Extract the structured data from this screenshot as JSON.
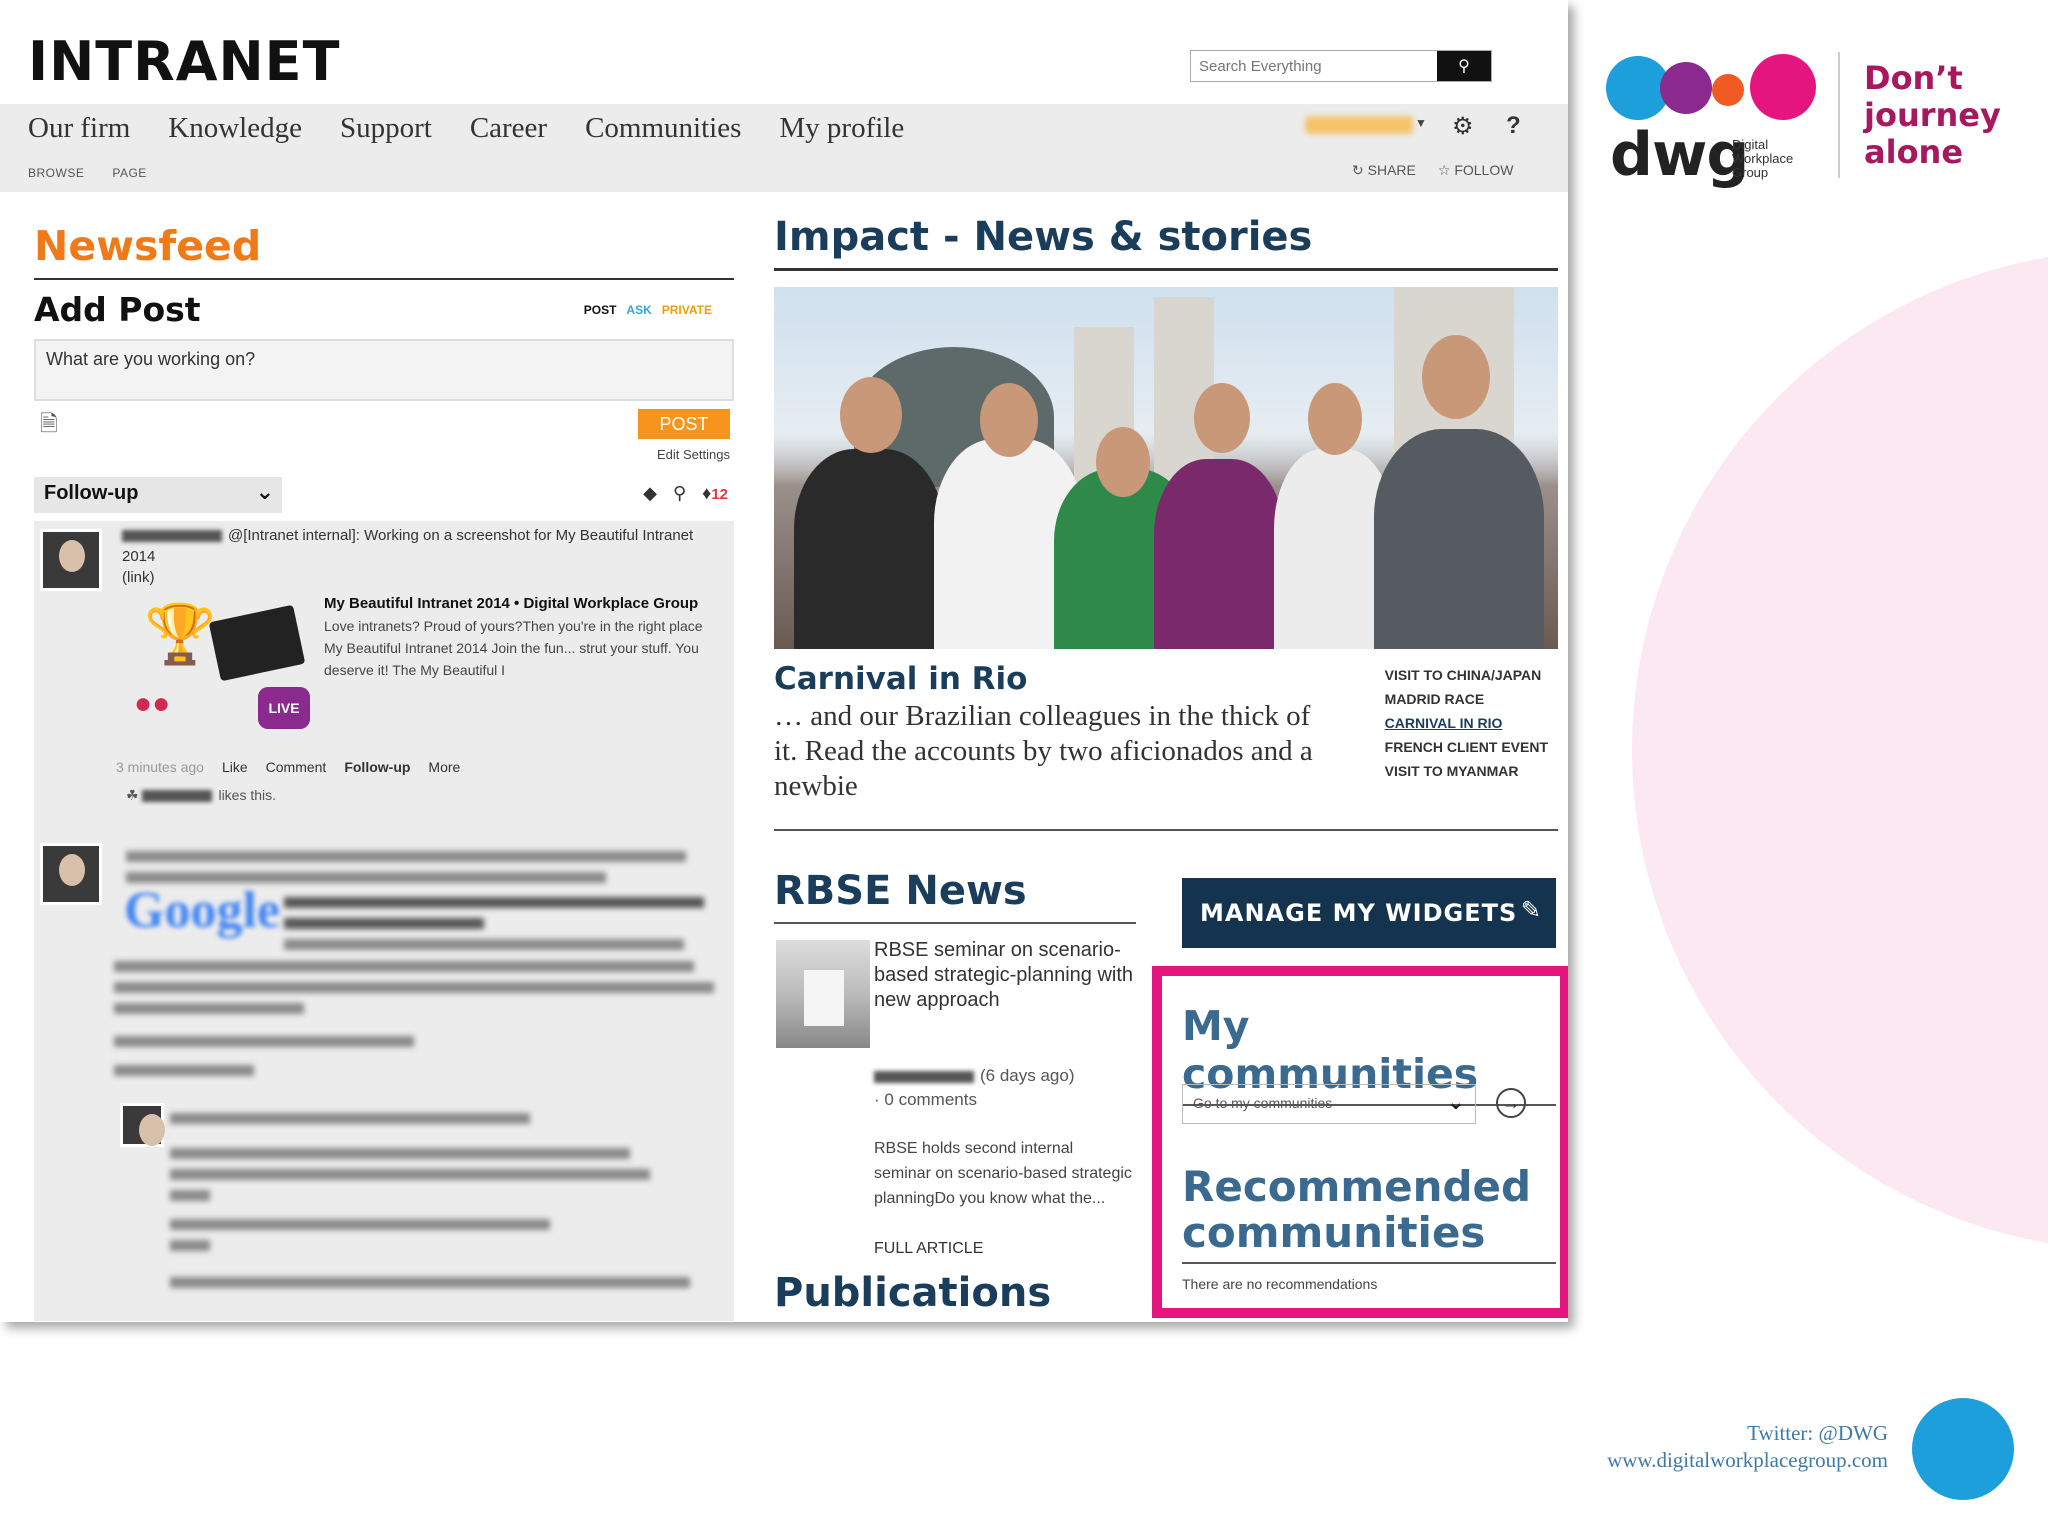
{
  "app": {
    "title": "INTRANET"
  },
  "search": {
    "placeholder": "Search Everything"
  },
  "nav": [
    "Our firm",
    "Knowledge",
    "Support",
    "Career",
    "Communities",
    "My profile"
  ],
  "subnav": [
    "BROWSE",
    "PAGE"
  ],
  "actions": {
    "share": "SHARE",
    "follow": "FOLLOW",
    "help": "?"
  },
  "newsfeed": {
    "title": "Newsfeed",
    "add_post": "Add Post",
    "post_tabs": [
      "POST",
      "ASK",
      "PRIVATE"
    ],
    "placeholder": "What are you working on?",
    "post_button": "POST",
    "edit_settings": "Edit Settings",
    "filter": "Follow-up",
    "notification_count": "12",
    "item1": {
      "text": "@[Intranet internal]: Working on a screenshot for My Beautiful Intranet",
      "year": "2014",
      "link": "(link)",
      "card_title": "My Beautiful Intranet 2014 • Digital Workplace Group",
      "card_text": "Love intranets? Proud of yours?Then you're in the right place My Beautiful Intranet 2014 Join the fun... strut your stuff. You deserve it! The My Beautiful I",
      "live": "LIVE",
      "time": "3 minutes ago",
      "like": "Like",
      "comment": "Comment",
      "followup": "Follow-up",
      "more": "More",
      "likes": "likes this."
    },
    "google_label": "Google"
  },
  "impact": {
    "title": "Impact - News & stories",
    "story_title": "Carnival in Rio",
    "story_text": "… and our Brazilian colleagues in the thick of it. Read the accounts by two aficionados and a newbie",
    "links": [
      "VISIT TO CHINA/JAPAN",
      "MADRID RACE",
      "CARNIVAL IN RIO",
      "FRENCH CLIENT EVENT",
      "VISIT TO MYANMAR"
    ]
  },
  "rbse": {
    "title": "RBSE News",
    "headline": "RBSE seminar on scenario-based strategic-planning with new approach",
    "age": "(6 days ago)",
    "comments": "0 comments",
    "body": "RBSE holds second internal seminar on scenario-based strategic planningDo you know what the...",
    "full": "FULL ARTICLE"
  },
  "publications": {
    "title": "Publications"
  },
  "widgets": {
    "label": "MANAGE MY WIDGETS"
  },
  "communities": {
    "title": "My communities",
    "select": "Go to my communities",
    "recommended": "Recommended communities",
    "none": "There are no recommendations"
  },
  "branding": {
    "logo": "dwg",
    "logo_sub": [
      "Digital",
      "Workplace",
      "Group"
    ],
    "tagline": [
      "Don’t",
      "journey",
      "alone"
    ],
    "twitter": "Twitter: @DWG",
    "url": "www.digitalworkplacegroup.com",
    "colors": {
      "blue": "#1c9fdb",
      "purple": "#8a2a8e",
      "orange": "#f15a22",
      "pink": "#e5157f"
    }
  }
}
